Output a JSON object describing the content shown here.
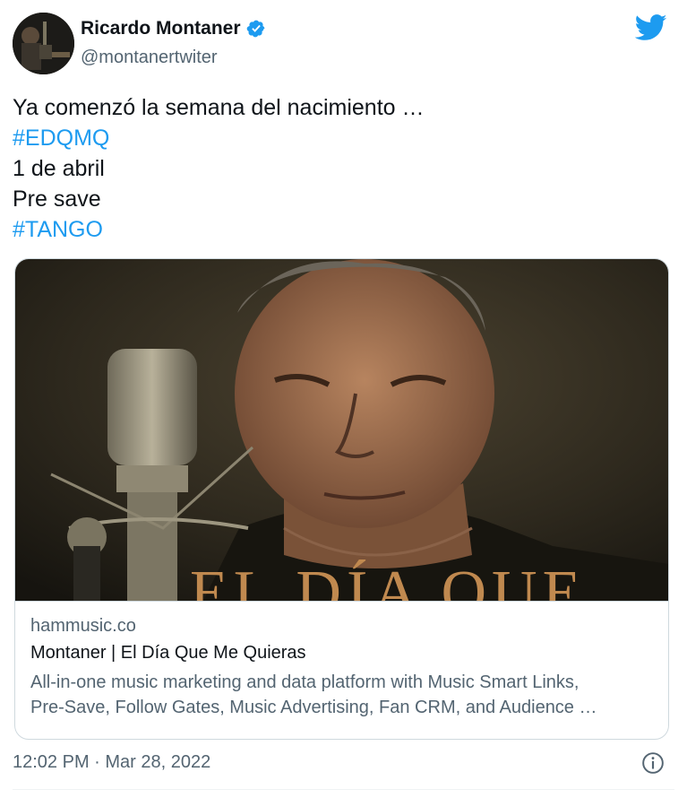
{
  "author": {
    "display_name": "Ricardo Montaner",
    "handle": "@montanertwiter",
    "verified_icon": "verified-badge-icon",
    "avatar_icon": "avatar"
  },
  "brand": {
    "icon": "twitter-bird-icon",
    "color": "#1d9bf0"
  },
  "tweet": {
    "lines": [
      "Ya comenzó la semana del nacimiento …",
      "#EDQMQ",
      "1 de abril",
      "Pre save",
      "#TANGO"
    ]
  },
  "card": {
    "image_overlay_text": "EL DÍA QUE",
    "domain": "hammusic.co",
    "title": "Montaner | El Día Que Me Quieras",
    "description_line1": "All-in-one music marketing and data platform with Music Smart Links,",
    "description_line2": "Pre-Save, Follow Gates, Music Advertising, Fan CRM, and Audience …"
  },
  "footer": {
    "timestamp": "12:02 PM · Mar 28, 2022",
    "info_icon": "info-icon"
  },
  "colors": {
    "link": "#1d9bf0",
    "text": "#0f1419",
    "secondary": "#536471",
    "border": "#cfd9de"
  }
}
